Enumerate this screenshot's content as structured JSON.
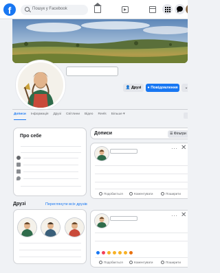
{
  "topbar": {
    "logo_letter": "f",
    "search_placeholder": "Пошук у Facebook"
  },
  "profile": {
    "buttons": {
      "friends": "Друзі",
      "message": "Повідомлення"
    },
    "tabs": [
      "Дописи",
      "Інформація",
      "Друзі",
      "Світлини",
      "Відео",
      "Reels",
      "Більше ▾"
    ]
  },
  "about": {
    "title": "Про себе"
  },
  "friends_section": {
    "title": "Друзі",
    "link": "Переглянути всіх друзів"
  },
  "posts": {
    "title": "Дописи",
    "filter_label": "Фільтри",
    "dots": "···",
    "close": "✕",
    "actions": {
      "like": "Подобається",
      "comment": "Коментувати",
      "share": "Поширити"
    }
  },
  "colors": {
    "accent": "#1877f2",
    "background": "#f0f2f5"
  },
  "reaction_colors": [
    "#1877f2",
    "#f33e58",
    "#f7b125",
    "#f7b125",
    "#f7b125",
    "#f7b125",
    "#e9710f"
  ]
}
